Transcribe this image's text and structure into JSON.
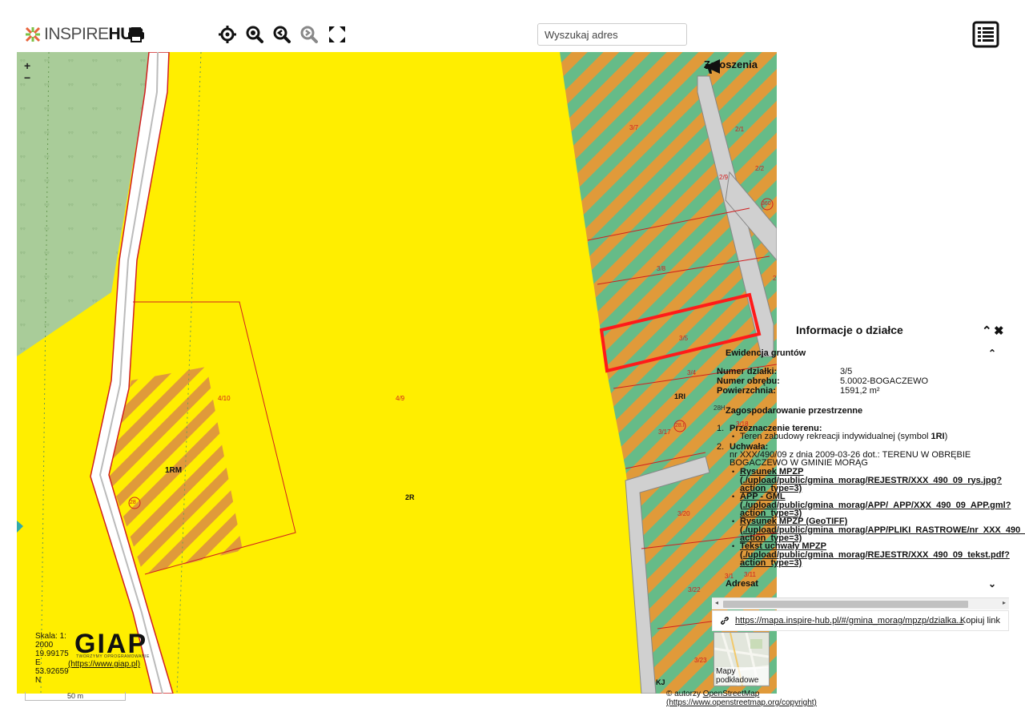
{
  "header": {
    "logo_inspire": "INSPIRE",
    "logo_hub": "HUB",
    "search_placeholder": "Wyszukaj adres"
  },
  "map": {
    "zoom_in": "+",
    "zoom_out": "−",
    "zgloszenia_label": "Zgłoszenia",
    "labels": {
      "p37": "3/7",
      "p21": "2/1",
      "p29": "2/9",
      "p22": "2/2",
      "p360": "360",
      "p38": "3/8",
      "p35": "3/5",
      "p34": "3/4",
      "p1ri": "1RI",
      "p28h": "28H",
      "p318": "3/18",
      "p317": "3/17",
      "p28i": "28.I",
      "p410": "4/10",
      "p49": "4/9",
      "p1rm": "1RM",
      "p28": "28",
      "p2r": "2R",
      "p320": "3/20",
      "p322": "3/22",
      "p323": "3/23",
      "p311": "3/11",
      "p31": "3/1",
      "kj": "KJ",
      "p2": "2"
    },
    "scale_text": [
      "Skala: 1:",
      "2000",
      "19.99175",
      "E",
      "53.92659",
      "N"
    ],
    "giap_logo": "GIAP",
    "giap_tagline": "TWORZYMY OPROGRAMOWANIE",
    "giap_link": "(https://www.giap.pl)",
    "scalebar": "50 m"
  },
  "info_panel": {
    "title": "Informacje o działce",
    "section_ewidencja": "Ewidencja gruntów",
    "numer_dzialki_label": "Numer działki:",
    "numer_dzialki_value": "3/5",
    "numer_obrebu_label": "Numer obrębu:",
    "numer_obrebu_value": "5.0002-BOGACZEWO",
    "powierzchnia_label": "Powierzchnia:",
    "powierzchnia_value": "1591,2 m²",
    "section_zagosp": "Zagospodarowanie przestrzenne",
    "przeznaczenie_num": "1.",
    "przeznaczenie_label": "Przeznaczenie terenu:",
    "przeznaczenie_text": "Teren zabudowy rekreacji indywidualnej (symbol",
    "przeznaczenie_symbol": "1RI",
    "przeznaczenie_close": ")",
    "uchwala_num": "2.",
    "uchwala_label": "Uchwała:",
    "uchwala_line1": "nr XXX/490/09 z dnia 2009-03-26 dot.: TERENU W OBRĘBIE",
    "uchwala_line2": "BOGACZEWO W GMINIE MORĄG",
    "links": [
      {
        "title": "Rysunek MPZP",
        "l1": "(./upload/public/gmina_morag/REJESTR/XXX_490_09_rys.jpg?",
        "l2": "action_type=3)"
      },
      {
        "title": "APP - GML",
        "l1": "(./upload/public/gmina_morag/APP/_APP/XXX_490_09_APP.gml?",
        "l2": "action_type=3)"
      },
      {
        "title": "Rysunek MPZP (GeoTIFF)",
        "l1": "(./upload/public/gmina_morag/APP/PLIKI_RASTROWE/nr_XXX_490_",
        "l2": "action_type=3)"
      },
      {
        "title": "Tekst uchwały MPZP",
        "l1": "(./upload/public/gmina_morag/REJESTR/XXX_490_09_tekst.pdf?",
        "l2": "action_type=3)"
      }
    ],
    "section_adresat": "Adresat",
    "share_url": "https://mapa.inspire-hub.pl/#/gmina_morag/mpzp/dzialka...",
    "copy_link": "Kopiuj link"
  },
  "basemaps_label": "Mapy podkładowe",
  "osm_prefix": "© autorzy ",
  "osm_link": "OpenStreetMap",
  "osm_url": "(https://www.openstreetmap.org/copyright)",
  "colors": {
    "plot_yellow": "#ffee00",
    "stripe_green": "#66bb88",
    "stripe_orange": "#e09a3a",
    "forest_green": "#a9cc99",
    "highlight_red": "#ff1a1a"
  }
}
